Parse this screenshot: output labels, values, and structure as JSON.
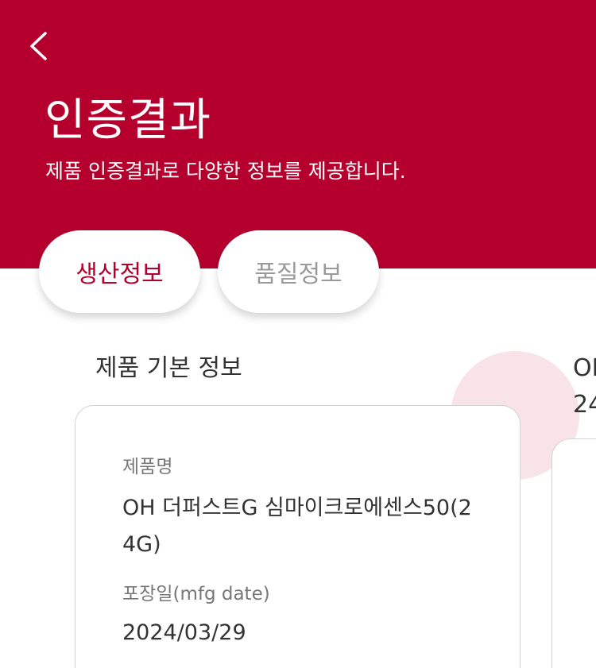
{
  "header": {
    "title": "인증결과",
    "subtitle": "제품 인증결과로 다양한 정보를 제공합니다.",
    "accent_color": "#b5002d",
    "back_icon": "chevron-left-icon"
  },
  "tabs": [
    {
      "label": "생산정보",
      "active": true
    },
    {
      "label": "품질정보",
      "active": false
    }
  ],
  "cards": [
    {
      "title": "제품 기본 정보",
      "fields": [
        {
          "label": "제품명",
          "value": "OH 더퍼스트G 심마이크로에센스50(24G)"
        },
        {
          "label": "포장일(mfg date)",
          "value": "2024/03/29"
        }
      ]
    },
    {
      "title_partial": "OI",
      "subtitle_partial": "24"
    }
  ]
}
